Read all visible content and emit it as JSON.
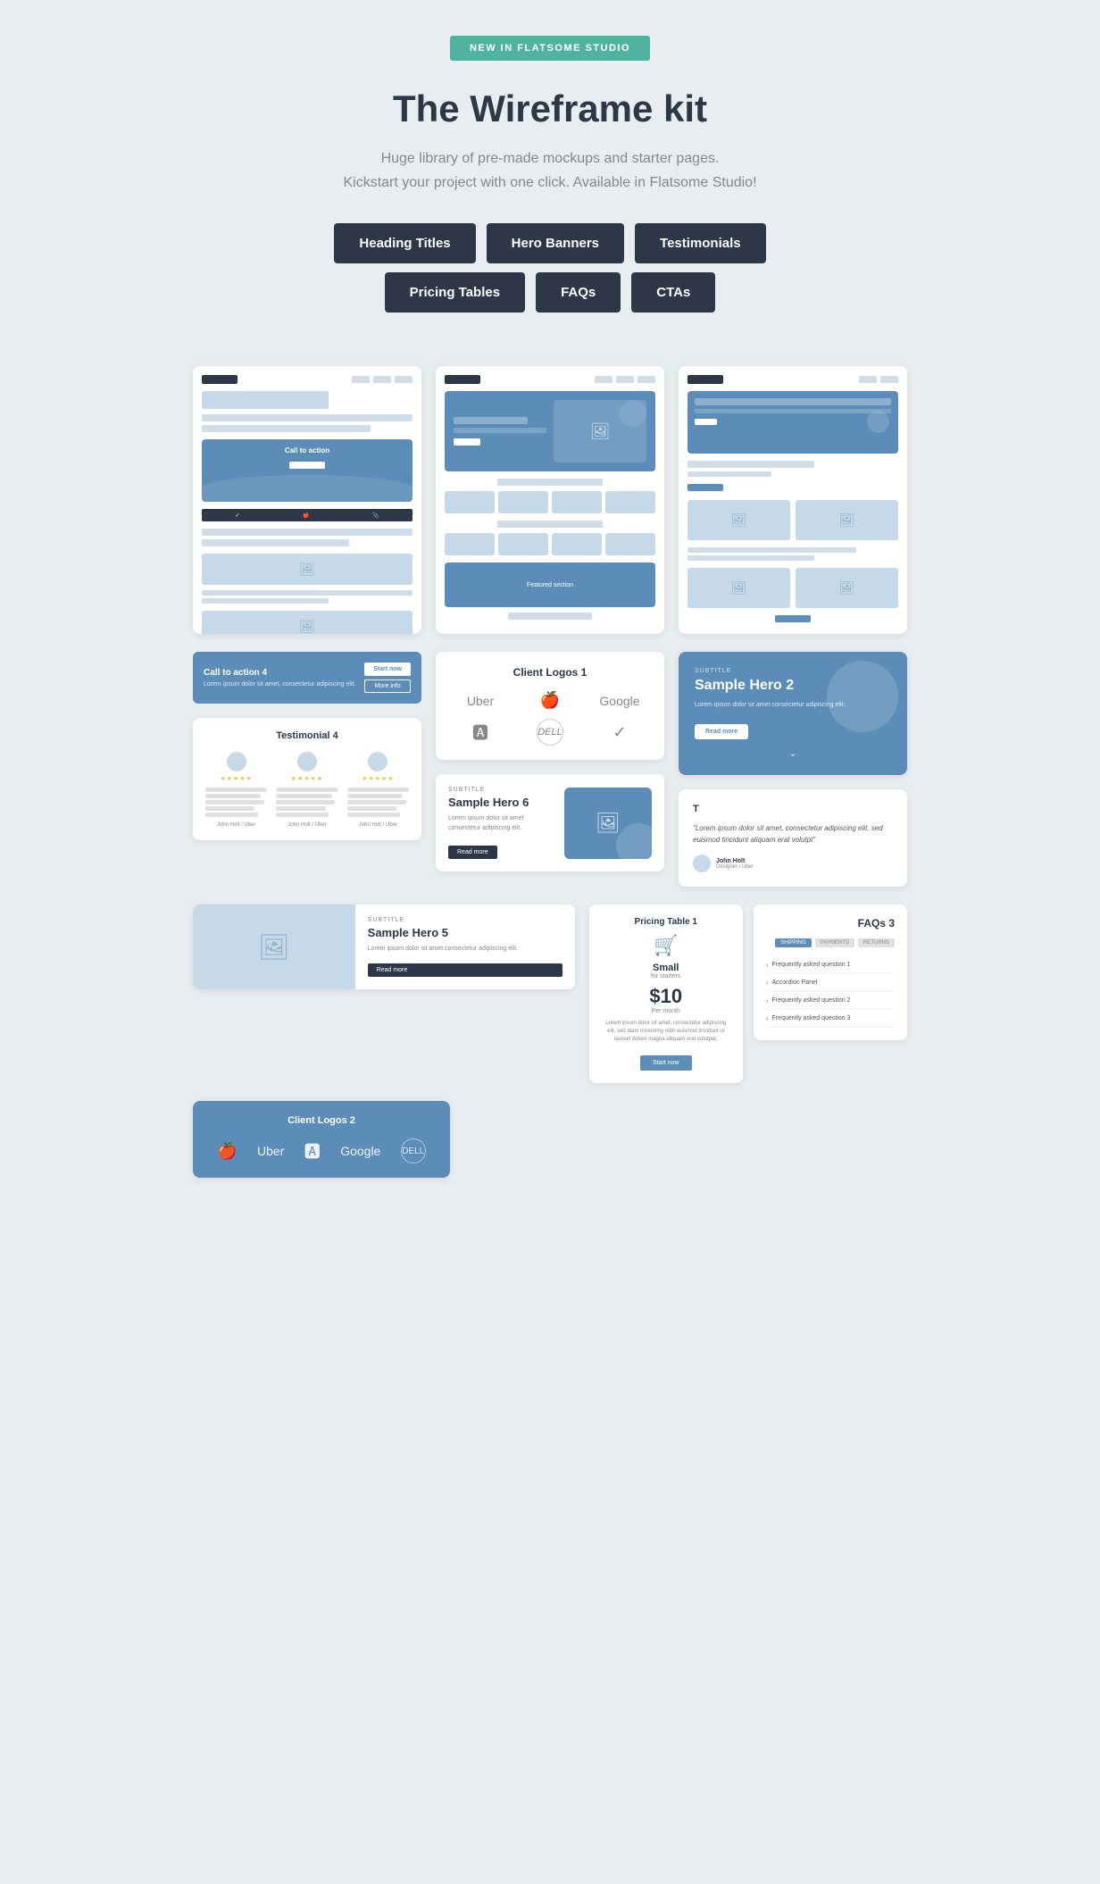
{
  "badge": "NEW IN FLATSOME STUDIO",
  "header": {
    "title": "The Wireframe kit",
    "subtitle_line1": "Huge library of pre-made mockups and starter pages.",
    "subtitle_line2": "Kickstart your project with one click. Available in Flatsome Studio!"
  },
  "buttons": {
    "heading_titles": "Heading Titles",
    "hero_banners": "Hero Banners",
    "testimonials": "Testimonials",
    "pricing_tables": "Pricing Tables",
    "faqs": "FAQs",
    "ctas": "CTAs"
  },
  "cta4": {
    "title": "Call to action 4",
    "desc": "Lorem ipsum dolor sit amet, consectetur adipiscing elit.",
    "btn1": "Start now",
    "btn2": "More info"
  },
  "testimonial4": {
    "title": "Testimonial 4",
    "items": [
      {
        "stars": "★★★★★",
        "author": "John Holt / Uber"
      },
      {
        "stars": "★★★★★",
        "author": "John Holt / Uber"
      },
      {
        "stars": "★★★★★",
        "author": "John Holt / Uber"
      }
    ]
  },
  "client_logos1": {
    "title": "Client Logos 1",
    "logos": [
      "Uber",
      "🍎",
      "Google",
      "🅰",
      "DELL",
      "✓"
    ]
  },
  "hero2": {
    "subtitle": "SUBTITLE",
    "title": "Sample Hero 2",
    "desc": "Lorem ipsum dolor sit amet consectetur adipiscing elit.",
    "btn": "Read more"
  },
  "hero5": {
    "subtitle": "SUBTITLE",
    "title": "Sample Hero 5",
    "desc": "Lorem ipsum dolor sit amet consectetur adipiscing elit.",
    "btn": "Read more"
  },
  "hero6": {
    "subtitle": "SUBTITLE",
    "title": "Sample Hero 6",
    "desc": "Lorem ipsum dolor sit amet consectetur adipiscing elit.",
    "btn": "Read more"
  },
  "pricing1": {
    "label": "Pricing Table 1",
    "plan": "Small",
    "for": "for starters",
    "price": "$10",
    "period": "Per month",
    "desc": "Lorem ipsum dolor sit amet, consectetur adipiscing elit, sed diam nonummy nibh euismod tincidunt ut laoreet dolore magna aliquam erat volutpat.",
    "btn": "Start now"
  },
  "faqs3": {
    "title": "FAQs 3",
    "tabs": [
      "SHIPPING",
      "PAYMENTS",
      "RETURNS"
    ],
    "items": [
      "Frequently asked question 1",
      "Accordion Panel",
      "Frequently asked question 2",
      "Frequently asked question 3"
    ]
  },
  "client_logos2": {
    "title": "Client Logos 2",
    "logos": [
      "🍎",
      "Uber",
      "🅰",
      "Google",
      "DELL"
    ]
  },
  "testimonial_quote": {
    "title": "T",
    "quote": "\"Lorem ipsum dolor sit amet, consectetur adipiscing elit, sed euismod tincidunt aliquam erat volutpt\"",
    "author_name": "John Holt",
    "author_role": "Designer / Uber"
  },
  "colors": {
    "blue": "#5b8db8",
    "dark": "#2d3748",
    "light_blue": "#c5d9e8",
    "teal": "#4fb3a0",
    "bg": "#e8edf0"
  }
}
